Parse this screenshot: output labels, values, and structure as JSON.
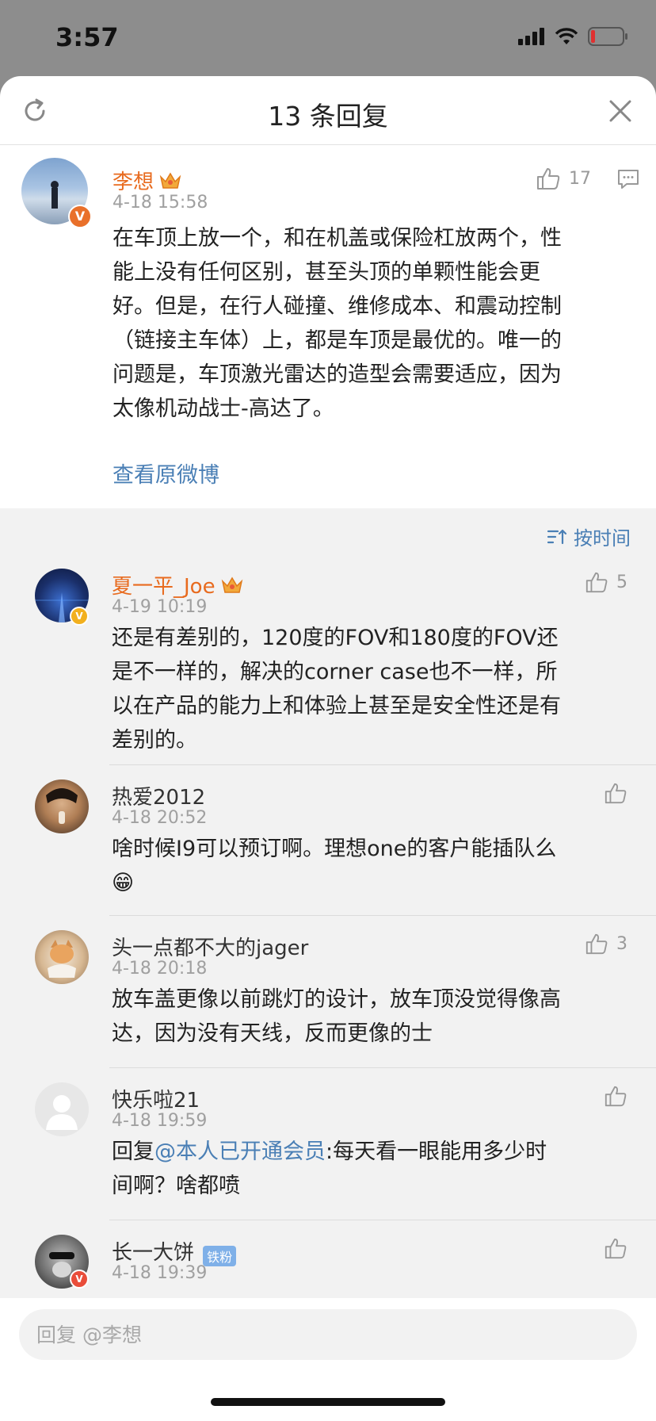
{
  "status_bar": {
    "time": "3:57"
  },
  "header": {
    "title": "13 条回复"
  },
  "main_post": {
    "username": "李想",
    "time": "4-18 15:58",
    "likes": "17",
    "text_lines": [
      "在车顶上放一个，和在机盖或保险杠放两个，性",
      "能上没有任何区别，甚至头顶的单颗性能会更",
      "好。但是，在行人碰撞、维修成本、和震动控制",
      "（链接主车体）上，都是车顶是最优的。唯一的",
      "问题是，车顶激光雷达的造型会需要适应，因为",
      "太像机动战士-高达了。"
    ],
    "view_original": "查看原微博"
  },
  "sort": {
    "label": "按时间"
  },
  "replies": [
    {
      "username": "夏一平_Joe",
      "time": "4-19 10:19",
      "likes": "5",
      "text_lines": [
        "还是有差别的，120度的FOV和180度的FOV还",
        "是不一样的，解决的corner case也不一样，所",
        "以在产品的能力上和体验上甚至是安全性还是有",
        "差别的。"
      ]
    },
    {
      "username": "热爱2012",
      "time": "4-18 20:52",
      "likes": "",
      "text_lines": [
        "啥时候I9可以预订啊。理想one的客户能插队么"
      ],
      "emoji": "😁"
    },
    {
      "username": "头一点都不大的jager",
      "time": "4-18 20:18",
      "likes": "3",
      "text_lines": [
        "放车盖更像以前跳灯的设计，放车顶没觉得像高",
        "达，因为没有天线，反而更像的士"
      ]
    },
    {
      "username": "快乐啦21",
      "time": "4-18 19:59",
      "likes": "",
      "reply_prefix": "回复",
      "mention": "@本人已开通会员",
      "text_after_mention": ":每天看一眼能用多少时",
      "text_line2": "间啊？啥都喷"
    },
    {
      "username": "长一大饼",
      "badge": "铁粉",
      "time": "4-18 19:39",
      "likes": ""
    }
  ],
  "reply_box": {
    "placeholder": "回复 @李想"
  },
  "colors": {
    "username_vip": "#e86b1f",
    "link_blue": "#4a7fb5",
    "verified_orange": "#e9702a",
    "verified_yellow": "#f2b01e"
  }
}
